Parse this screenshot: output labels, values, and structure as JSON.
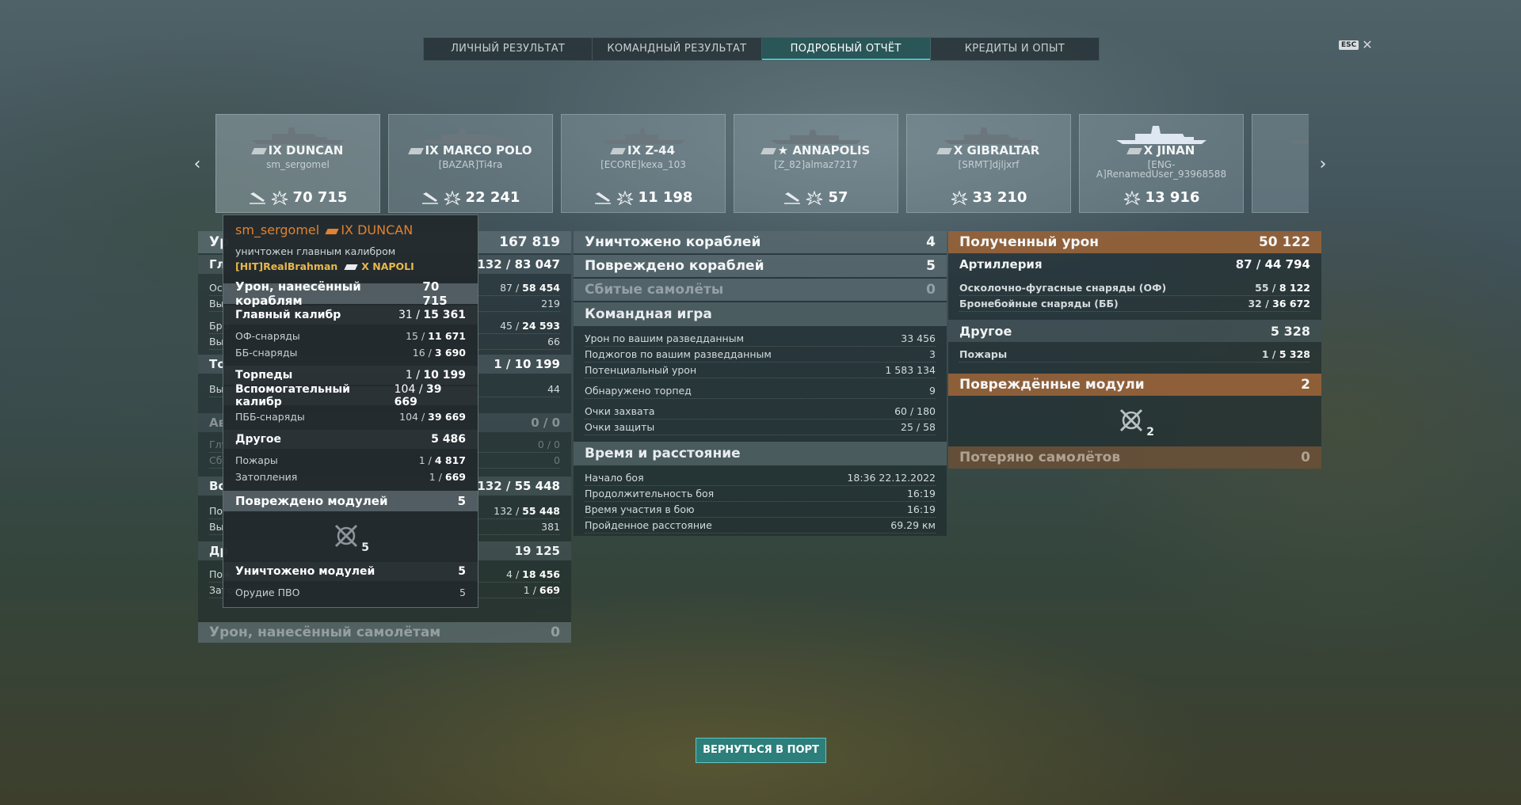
{
  "tabs": [
    "ЛИЧНЫЙ РЕЗУЛЬТАТ",
    "КОМАНДНЫЙ РЕЗУЛЬТАТ",
    "ПОДРОБНЫЙ ОТЧЁТ",
    "КРЕДИТЫ И ОПЫТ"
  ],
  "active_tab": "ПОДРОБНЫЙ ОТЧЁТ",
  "esc": {
    "key": "ESC",
    "close": "✕"
  },
  "ships": [
    {
      "name": "IX DUNCAN",
      "player": "sm_sergomel",
      "damage": "70 715",
      "icons": [
        "sunk-ship-icon",
        "damage-burst-icon"
      ]
    },
    {
      "name": "IX MARCO POLO",
      "player": "[BAZAR]Ti4ra",
      "damage": "22 241",
      "icons": [
        "sunk-ship-icon",
        "damage-burst-icon"
      ]
    },
    {
      "name": "IX Z-44",
      "player": "[ECORE]kexa_103",
      "damage": "11 198",
      "icons": [
        "sunk-ship-icon",
        "damage-burst-icon"
      ]
    },
    {
      "name": "★ ANNAPOLIS",
      "player": "[Z_82]almaz7217",
      "damage": "57",
      "icons": [
        "sunk-ship-icon",
        "damage-burst-icon"
      ]
    },
    {
      "name": "X GIBRALTAR",
      "player": "[SRMT]djljxrf",
      "damage": "33 210",
      "icons": [
        "damage-burst-icon"
      ]
    },
    {
      "name": "X JINAN",
      "player": "[ENG-A]RenamedUser_93968588",
      "damage": "13 916",
      "icons": [
        "damage-burst-icon"
      ]
    }
  ],
  "left": {
    "total_label": "Ур",
    "total_value": "167 819",
    "rows": [
      {
        "label": "Гл",
        "a": "132",
        "b": "83 047"
      },
      {
        "label": "Оск",
        "a": "87",
        "b": "58 454"
      },
      {
        "label": "Вы",
        "value": "219"
      },
      {
        "label": "Бро",
        "a": "45",
        "b": "24 593"
      },
      {
        "label": "Вы",
        "value": "66"
      },
      {
        "label": "То",
        "a": "1",
        "b": "10 199"
      },
      {
        "label": "Вы",
        "value": "44"
      },
      {
        "label": "Ав",
        "value": "0 / 0"
      },
      {
        "label": "Глу",
        "value": "0 / 0"
      },
      {
        "label": "Сбр",
        "value": "0"
      },
      {
        "label": "Вс",
        "a": "132",
        "b": "55 448"
      },
      {
        "label": "Пол",
        "a": "132",
        "b": "55 448"
      },
      {
        "label": "Вы",
        "value": "381"
      },
      {
        "label": "Др",
        "value": "19 125"
      },
      {
        "label": "Пож",
        "a": "4",
        "b": "18 456"
      },
      {
        "label": "Затопления",
        "a": "1",
        "b": "669"
      }
    ],
    "aircraft_label": "Урон, нанесённый самолётам",
    "aircraft_value": "0"
  },
  "middle": {
    "destroyed_label": "Уничтожено кораблей",
    "destroyed_value": "4",
    "damaged_label": "Повреждено кораблей",
    "damaged_value": "5",
    "planes_label": "Сбитые самолёты",
    "planes_value": "0",
    "team_title": "Командная игра",
    "team_rows": [
      {
        "label": "Урон по вашим разведданным",
        "value": "33 456"
      },
      {
        "label": "Поджогов по вашим разведданным",
        "value": "3"
      },
      {
        "label": "Потенциальный урон",
        "value": "1 583 134"
      },
      {
        "label": "Обнаружено торпед",
        "value": "9"
      },
      {
        "label": "Очки захвата",
        "value": "60 / 180"
      },
      {
        "label": "Очки защиты",
        "value": "25 / 58"
      }
    ],
    "time_title": "Время и расстояние",
    "time_rows": [
      {
        "label": "Начало боя",
        "value": "18:36  22.12.2022"
      },
      {
        "label": "Продолжительность боя",
        "value": "16:19"
      },
      {
        "label": "Время участия в бою",
        "value": "16:19"
      },
      {
        "label": "Пройденное расстояние",
        "value": "69.29 км"
      }
    ]
  },
  "right": {
    "received_label": "Полученный урон",
    "received_value": "50 122",
    "artillery_label": "Артиллерия",
    "artillery_a": "87",
    "artillery_b": "44 794",
    "he_label": "Осколочно-фугасные снаряды (ОФ)",
    "he_a": "55",
    "he_b": "8 122",
    "ap_label": "Бронебойные снаряды (ББ)",
    "ap_a": "32",
    "ap_b": "36 672",
    "other_label": "Другое",
    "other_value": "5 328",
    "fires_label": "Пожары",
    "fires_a": "1",
    "fires_b": "5 328",
    "modules_label": "Повреждённые модули",
    "modules_value": "2",
    "modules_icon_count": "2",
    "planes_lost_label": "Потеряно самолётов",
    "planes_lost_value": "0"
  },
  "tooltip": {
    "player": "sm_sergomel",
    "ship": "IX DUNCAN",
    "destroyed_by": "уничтожен главным калибром",
    "killer_player": "[HIT]RealBrahman",
    "killer_ship": "X NAPOLI",
    "damage_label": "Урон, нанесённый кораблям",
    "damage_value": "70 715",
    "main_label": "Главный калибр",
    "main_a": "31",
    "main_b": "15 361",
    "he_label": "ОФ-снаряды",
    "he_a": "15",
    "he_b": "11 671",
    "ap_label": "ББ-снаряды",
    "ap_a": "16",
    "ap_b": "3 690",
    "torp_label": "Торпеды",
    "torp_a": "1",
    "torp_b": "10 199",
    "sec_label": "Вспомогательный калибр",
    "sec_a": "104",
    "sec_b": "39 669",
    "sap_label": "ПББ-снаряды",
    "sap_a": "104",
    "sap_b": "39 669",
    "other_label": "Другое",
    "other_value": "5 486",
    "fires_label": "Пожары",
    "fires_a": "1",
    "fires_b": "4 817",
    "flood_label": "Затопления",
    "flood_a": "1",
    "flood_b": "669",
    "modules_label": "Повреждено модулей",
    "modules_value": "5",
    "modules_icon_count": "5",
    "destroyed_modules_label": "Уничтожено модулей",
    "destroyed_modules_value": "5",
    "aa_label": "Орудие ПВО",
    "aa_value": "5"
  },
  "return_button": "ВЕРНУТЬСЯ В ПОРТ",
  "colors": {
    "accent": "#2c7f7b",
    "orange_header": "#b06e3a",
    "player_orange": "#e0822f",
    "killer_gold": "#e8b84a"
  }
}
